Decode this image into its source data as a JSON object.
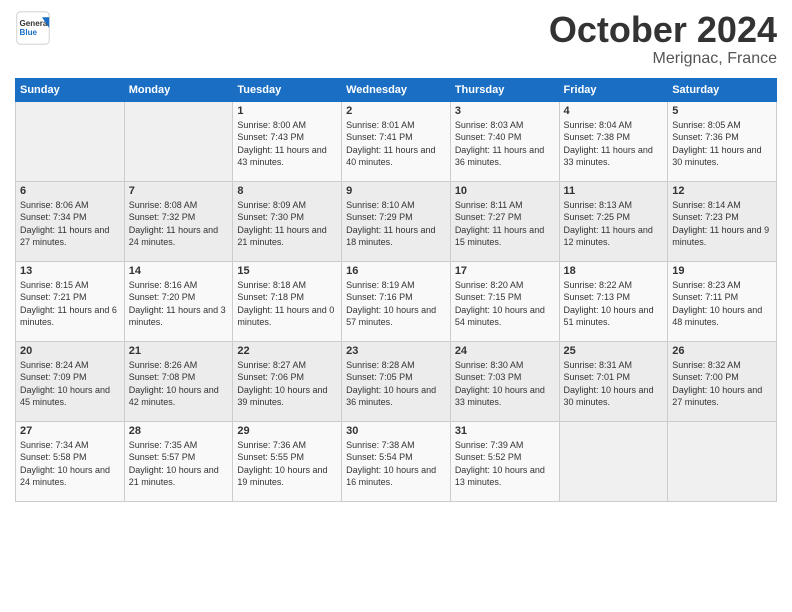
{
  "header": {
    "logo_general": "General",
    "logo_blue": "Blue",
    "month_title": "October 2024",
    "location": "Merignac, France"
  },
  "days_of_week": [
    "Sunday",
    "Monday",
    "Tuesday",
    "Wednesday",
    "Thursday",
    "Friday",
    "Saturday"
  ],
  "weeks": [
    [
      {
        "day": "",
        "info": ""
      },
      {
        "day": "",
        "info": ""
      },
      {
        "day": "1",
        "info": "Sunrise: 8:00 AM\nSunset: 7:43 PM\nDaylight: 11 hours and 43 minutes."
      },
      {
        "day": "2",
        "info": "Sunrise: 8:01 AM\nSunset: 7:41 PM\nDaylight: 11 hours and 40 minutes."
      },
      {
        "day": "3",
        "info": "Sunrise: 8:03 AM\nSunset: 7:40 PM\nDaylight: 11 hours and 36 minutes."
      },
      {
        "day": "4",
        "info": "Sunrise: 8:04 AM\nSunset: 7:38 PM\nDaylight: 11 hours and 33 minutes."
      },
      {
        "day": "5",
        "info": "Sunrise: 8:05 AM\nSunset: 7:36 PM\nDaylight: 11 hours and 30 minutes."
      }
    ],
    [
      {
        "day": "6",
        "info": "Sunrise: 8:06 AM\nSunset: 7:34 PM\nDaylight: 11 hours and 27 minutes."
      },
      {
        "day": "7",
        "info": "Sunrise: 8:08 AM\nSunset: 7:32 PM\nDaylight: 11 hours and 24 minutes."
      },
      {
        "day": "8",
        "info": "Sunrise: 8:09 AM\nSunset: 7:30 PM\nDaylight: 11 hours and 21 minutes."
      },
      {
        "day": "9",
        "info": "Sunrise: 8:10 AM\nSunset: 7:29 PM\nDaylight: 11 hours and 18 minutes."
      },
      {
        "day": "10",
        "info": "Sunrise: 8:11 AM\nSunset: 7:27 PM\nDaylight: 11 hours and 15 minutes."
      },
      {
        "day": "11",
        "info": "Sunrise: 8:13 AM\nSunset: 7:25 PM\nDaylight: 11 hours and 12 minutes."
      },
      {
        "day": "12",
        "info": "Sunrise: 8:14 AM\nSunset: 7:23 PM\nDaylight: 11 hours and 9 minutes."
      }
    ],
    [
      {
        "day": "13",
        "info": "Sunrise: 8:15 AM\nSunset: 7:21 PM\nDaylight: 11 hours and 6 minutes."
      },
      {
        "day": "14",
        "info": "Sunrise: 8:16 AM\nSunset: 7:20 PM\nDaylight: 11 hours and 3 minutes."
      },
      {
        "day": "15",
        "info": "Sunrise: 8:18 AM\nSunset: 7:18 PM\nDaylight: 11 hours and 0 minutes."
      },
      {
        "day": "16",
        "info": "Sunrise: 8:19 AM\nSunset: 7:16 PM\nDaylight: 10 hours and 57 minutes."
      },
      {
        "day": "17",
        "info": "Sunrise: 8:20 AM\nSunset: 7:15 PM\nDaylight: 10 hours and 54 minutes."
      },
      {
        "day": "18",
        "info": "Sunrise: 8:22 AM\nSunset: 7:13 PM\nDaylight: 10 hours and 51 minutes."
      },
      {
        "day": "19",
        "info": "Sunrise: 8:23 AM\nSunset: 7:11 PM\nDaylight: 10 hours and 48 minutes."
      }
    ],
    [
      {
        "day": "20",
        "info": "Sunrise: 8:24 AM\nSunset: 7:09 PM\nDaylight: 10 hours and 45 minutes."
      },
      {
        "day": "21",
        "info": "Sunrise: 8:26 AM\nSunset: 7:08 PM\nDaylight: 10 hours and 42 minutes."
      },
      {
        "day": "22",
        "info": "Sunrise: 8:27 AM\nSunset: 7:06 PM\nDaylight: 10 hours and 39 minutes."
      },
      {
        "day": "23",
        "info": "Sunrise: 8:28 AM\nSunset: 7:05 PM\nDaylight: 10 hours and 36 minutes."
      },
      {
        "day": "24",
        "info": "Sunrise: 8:30 AM\nSunset: 7:03 PM\nDaylight: 10 hours and 33 minutes."
      },
      {
        "day": "25",
        "info": "Sunrise: 8:31 AM\nSunset: 7:01 PM\nDaylight: 10 hours and 30 minutes."
      },
      {
        "day": "26",
        "info": "Sunrise: 8:32 AM\nSunset: 7:00 PM\nDaylight: 10 hours and 27 minutes."
      }
    ],
    [
      {
        "day": "27",
        "info": "Sunrise: 7:34 AM\nSunset: 5:58 PM\nDaylight: 10 hours and 24 minutes."
      },
      {
        "day": "28",
        "info": "Sunrise: 7:35 AM\nSunset: 5:57 PM\nDaylight: 10 hours and 21 minutes."
      },
      {
        "day": "29",
        "info": "Sunrise: 7:36 AM\nSunset: 5:55 PM\nDaylight: 10 hours and 19 minutes."
      },
      {
        "day": "30",
        "info": "Sunrise: 7:38 AM\nSunset: 5:54 PM\nDaylight: 10 hours and 16 minutes."
      },
      {
        "day": "31",
        "info": "Sunrise: 7:39 AM\nSunset: 5:52 PM\nDaylight: 10 hours and 13 minutes."
      },
      {
        "day": "",
        "info": ""
      },
      {
        "day": "",
        "info": ""
      }
    ]
  ]
}
